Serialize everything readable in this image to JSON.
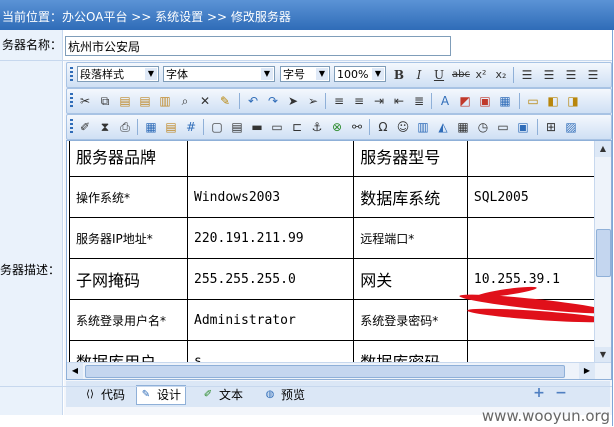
{
  "header": {
    "breadcrumb": "当前位置：办公OA平台 >> 系统设置 >> 修改服务器"
  },
  "form": {
    "name_label": "务器名称：",
    "name_value": "杭州市公安局",
    "desc_label": "务器描述："
  },
  "toolbar": {
    "paragraph_style": "段落样式",
    "font": "字体",
    "font_size": "字号",
    "zoom": "100%",
    "bold": "B",
    "italic": "I",
    "underline": "U",
    "strike": "abc",
    "superscript": "x²",
    "subscript": "x₂",
    "special_char": "Ω"
  },
  "content_table": {
    "rows": [
      [
        "服务器品牌",
        "",
        "服务器型号",
        ""
      ],
      [
        "操作系统*",
        "Windows2003",
        "数据库系统",
        "SQL2005"
      ],
      [
        "服务器IP地址*",
        "220.191.211.99",
        "远程端口*",
        ""
      ],
      [
        "子网掩码",
        "255.255.255.0",
        "网关",
        "10.255.39.1"
      ],
      [
        "系统登录用户名*",
        "Administrator",
        "系统登录密码*",
        ""
      ],
      [
        "数据库用户",
        "s",
        "数据库密码",
        ""
      ]
    ]
  },
  "modes": {
    "code": "代码",
    "design": "设计",
    "text": "文本",
    "preview": "预览"
  },
  "colors": {
    "header_bg": "#2f6cb8",
    "label_bg": "#eaf2fb",
    "redaction": "#e0101a"
  },
  "watermark": "www.wooyun.org"
}
